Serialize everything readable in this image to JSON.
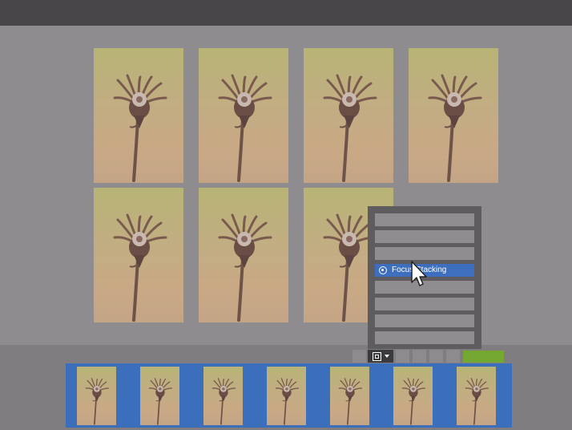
{
  "menu": {
    "items": [
      "",
      "",
      "",
      "Focus Stacking",
      "",
      "",
      "",
      ""
    ],
    "active_index": 3
  },
  "toolbar": {
    "buttons": [
      "",
      "",
      "",
      "",
      "",
      ""
    ],
    "accent_color": "#74a832"
  },
  "gallery": {
    "photo_count": 7
  },
  "filmstrip": {
    "thumbnail_count": 7,
    "selected_color": "#3b6fbb"
  },
  "icons": [
    "focus-stacking-icon",
    "stack-mode-icon",
    "chevron-down-icon",
    "mouse-cursor-icon"
  ]
}
